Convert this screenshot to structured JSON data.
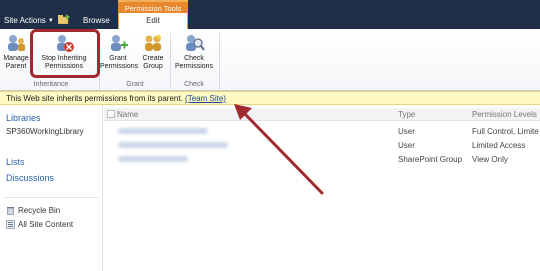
{
  "topbar": {
    "site_actions": "Site Actions",
    "browse": "Browse",
    "context_group": "Permission Tools",
    "edit": "Edit"
  },
  "ribbon": {
    "groups": {
      "inheritance": "Inheritance",
      "grant": "Grant",
      "check": "Check"
    },
    "buttons": {
      "manage_parent": [
        "Manage",
        "Parent"
      ],
      "stop_inheriting": [
        "Stop Inheriting",
        "Permissions"
      ],
      "grant_permissions": [
        "Grant",
        "Permissions"
      ],
      "create_group": [
        "Create",
        "Group"
      ],
      "check_permissions": [
        "Check",
        "Permissions"
      ]
    }
  },
  "status": {
    "text": "This Web site inherits permissions from its parent. ",
    "link": "(Team Site)"
  },
  "leftnav": {
    "libraries": "Libraries",
    "library_item": "SP360WorkingLibrary",
    "lists": "Lists",
    "discussions": "Discussions",
    "recycle_bin": "Recycle Bin",
    "all_site_content": "All Site Content"
  },
  "table": {
    "headers": {
      "name": "Name",
      "type": "Type",
      "permission": "Permission Levels"
    },
    "rows": [
      {
        "type": "User",
        "permission": "Full Control, Limite"
      },
      {
        "type": "User",
        "permission": "Limited Access"
      },
      {
        "type": "SharePoint Group",
        "permission": "View Only"
      }
    ]
  },
  "colors": {
    "topbar": "#1f2f47",
    "context_tab": "#e8872b",
    "status_bg": "#fff9c4",
    "arrow": "#a22a2e"
  }
}
